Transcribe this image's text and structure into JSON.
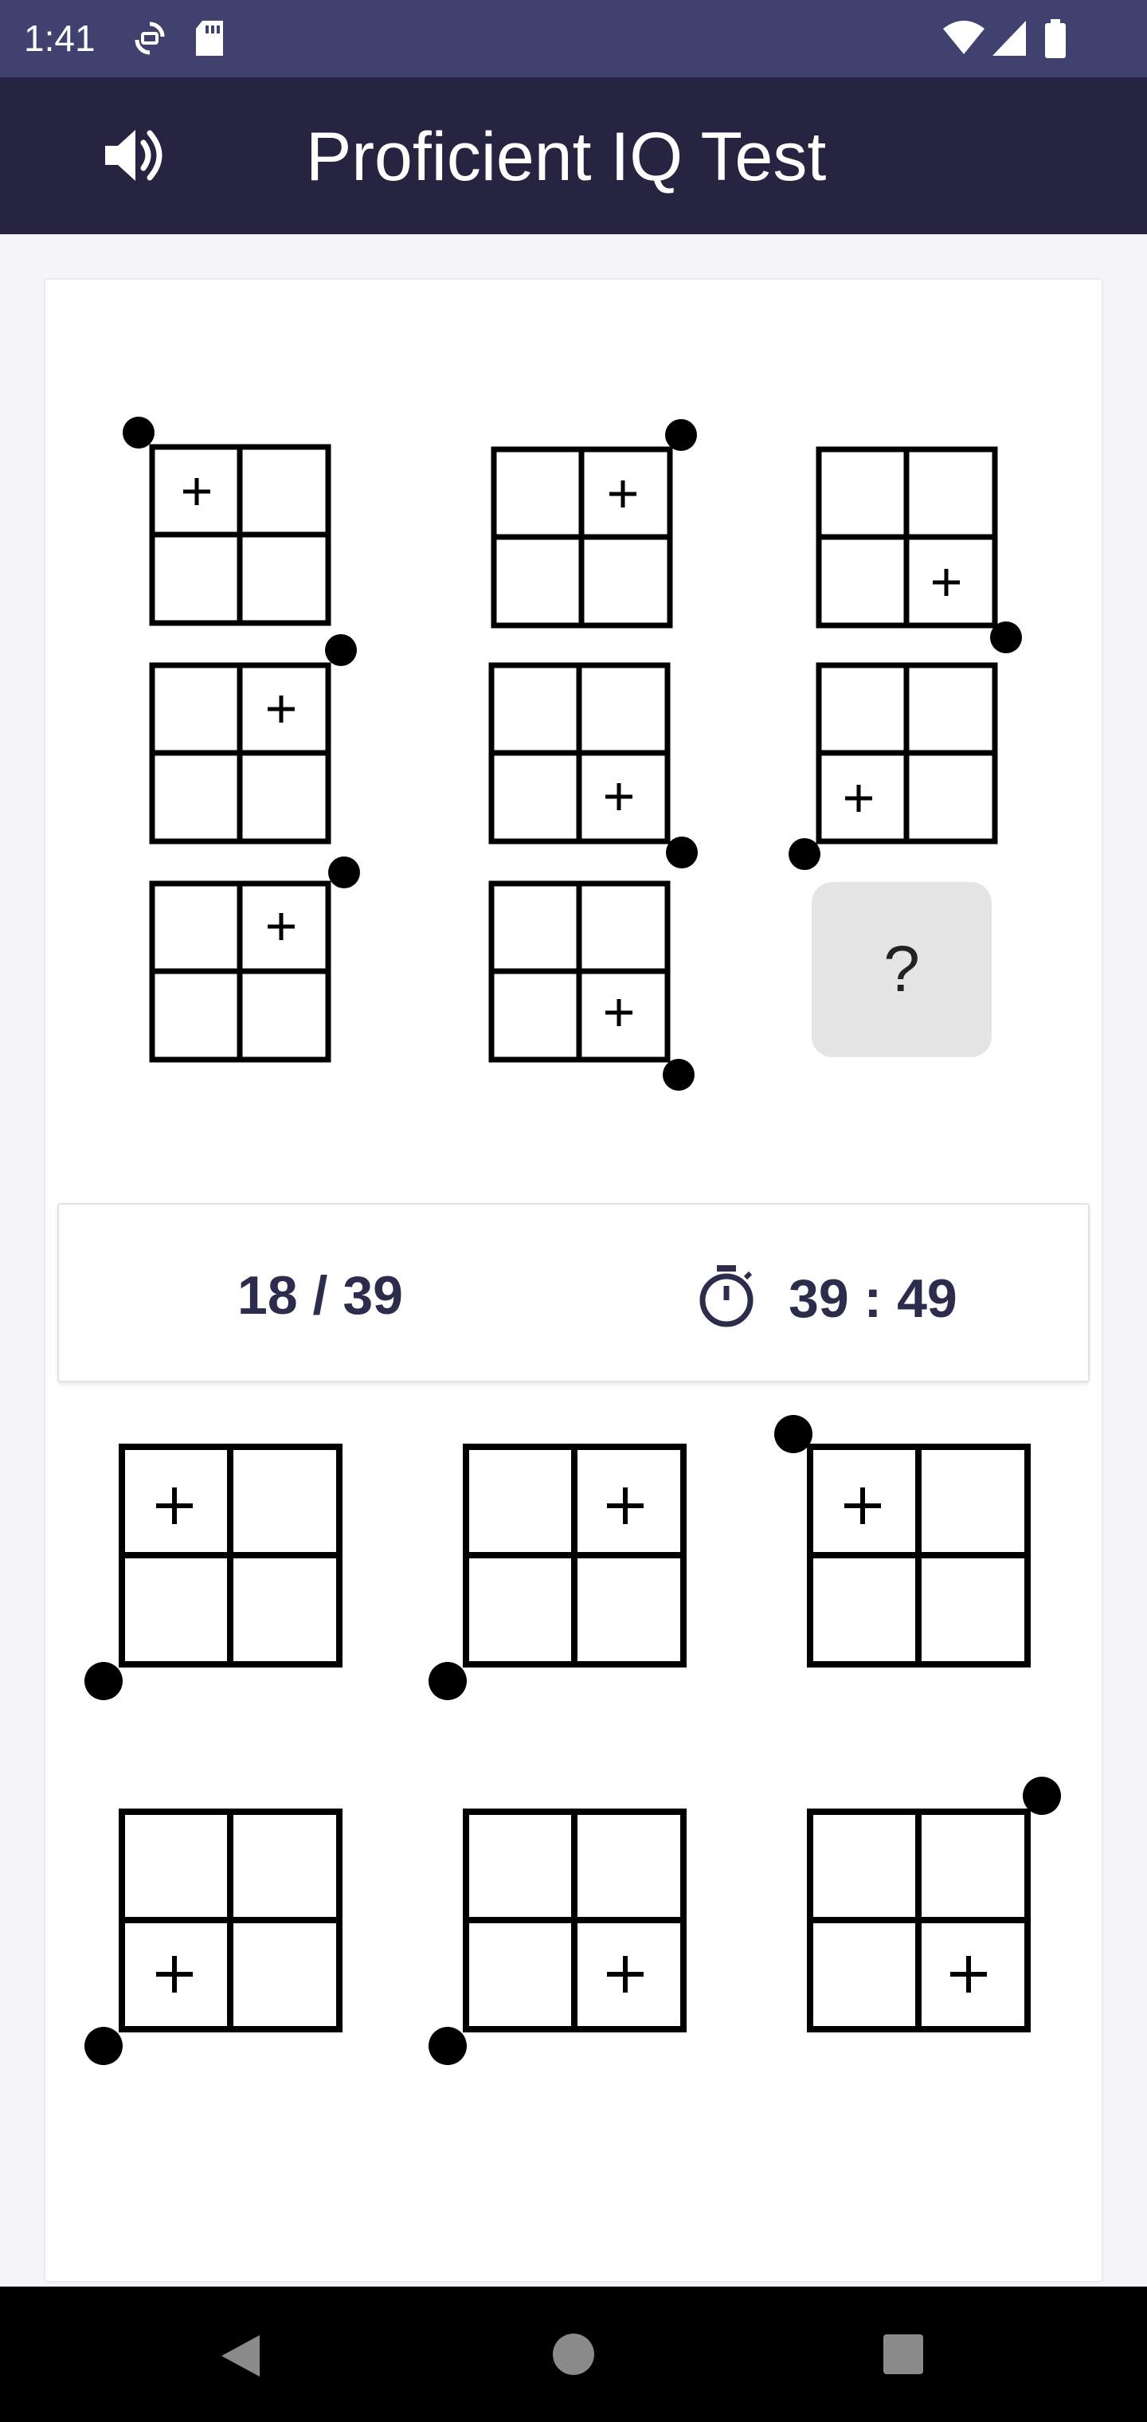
{
  "status_bar": {
    "time": "1:41",
    "icons": [
      "sync-icon",
      "sd-card-icon",
      "wifi-icon",
      "signal-icon",
      "battery-icon"
    ]
  },
  "app_bar": {
    "title": "Proficient IQ Test",
    "sound_icon": "volume-icon"
  },
  "puzzle": {
    "question_mark": "?"
  },
  "info": {
    "progress": "18 / 39",
    "timer": "39 : 49",
    "timer_icon": "stopwatch-icon"
  },
  "nav": {
    "buttons": [
      "back-icon",
      "home-icon",
      "recents-icon"
    ]
  },
  "colors": {
    "status_bar": "#40416e",
    "app_bar": "#272441",
    "text_dark": "#2c2c4d",
    "question_bg": "#e5e5e5"
  }
}
